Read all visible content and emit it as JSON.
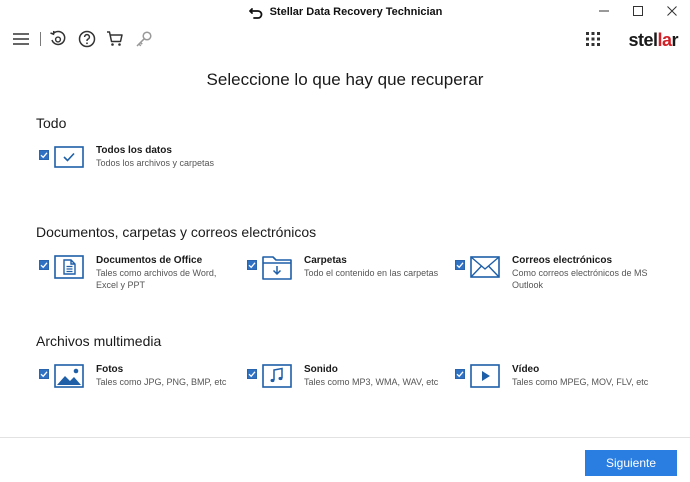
{
  "window": {
    "title": "Stellar Data Recovery Technician",
    "minimize": "—",
    "maximize": "☐",
    "close": "✕"
  },
  "toolbar": {
    "brand_prefix": "stel",
    "brand_accent": "la",
    "brand_suffix": "r",
    "brand_accent_color": "#d32027"
  },
  "main": {
    "heading": "Seleccione lo que hay que recuperar"
  },
  "sections": {
    "todo": {
      "title": "Todo",
      "items": [
        {
          "name": "Todos los datos",
          "desc": "Todos los archivos y carpetas",
          "checked": true,
          "icon": "check-box-icon"
        }
      ]
    },
    "documentos": {
      "title": "Documentos, carpetas y correos electrónicos",
      "items": [
        {
          "name": "Documentos de Office",
          "desc": "Tales como archivos de Word, Excel y PPT",
          "checked": true,
          "icon": "document-icon"
        },
        {
          "name": "Carpetas",
          "desc": "Todo el contenido en las carpetas",
          "checked": true,
          "icon": "folder-icon"
        },
        {
          "name": "Correos electrónicos",
          "desc": "Como correos electrónicos de MS Outlook",
          "checked": true,
          "icon": "mail-icon"
        }
      ]
    },
    "multimedia": {
      "title": "Archivos multimedia",
      "items": [
        {
          "name": "Fotos",
          "desc": "Tales como JPG, PNG, BMP, etc",
          "checked": true,
          "icon": "photo-icon"
        },
        {
          "name": "Sonido",
          "desc": "Tales como MP3, WMA, WAV, etc",
          "checked": true,
          "icon": "music-icon"
        },
        {
          "name": "Vídeo",
          "desc": "Tales como MPEG, MOV, FLV, etc",
          "checked": true,
          "icon": "video-icon"
        }
      ]
    }
  },
  "footer": {
    "next_label": "Siguiente"
  },
  "colors": {
    "accent": "#2a7de1",
    "checkbox": "#2f72c4",
    "icon_stroke": "#1e5fa8"
  }
}
